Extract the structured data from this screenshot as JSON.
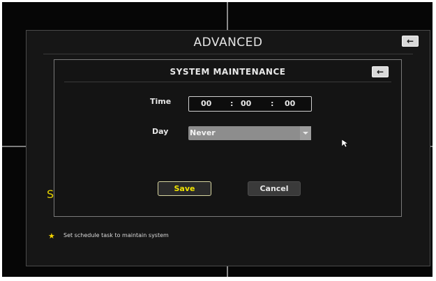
{
  "advanced": {
    "title": "ADVANCED",
    "back_icon": "arrow-left-icon",
    "partial_letter": "S",
    "hint": "Set schedule task to maintain system"
  },
  "dialog": {
    "title": "SYSTEM MAINTENANCE",
    "back_icon": "arrow-left-icon",
    "time": {
      "label": "Time",
      "hours": "00",
      "minutes": "00",
      "seconds": "00",
      "separator": ":"
    },
    "day": {
      "label": "Day",
      "selected": "Never"
    },
    "buttons": {
      "save": "Save",
      "cancel": "Cancel"
    }
  },
  "colors": {
    "accent_yellow": "#f1e400",
    "panel_bg": "#161616",
    "dialog_border": "#7a7a7a"
  }
}
